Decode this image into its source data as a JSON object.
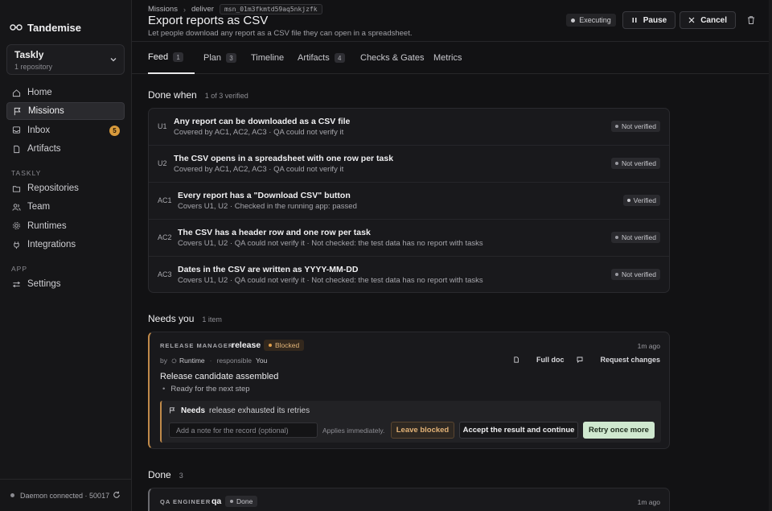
{
  "brand": {
    "name": "Tandemise"
  },
  "workspace": {
    "name": "Taskly",
    "sub": "1 repository"
  },
  "nav": {
    "main": [
      {
        "label": "Home",
        "icon": "home-icon"
      },
      {
        "label": "Missions",
        "icon": "flag-icon",
        "active": true
      },
      {
        "label": "Inbox",
        "icon": "inbox-icon",
        "badge": "5"
      },
      {
        "label": "Artifacts",
        "icon": "file-icon"
      }
    ],
    "section1": "TASKLY",
    "taskly": [
      {
        "label": "Repositories",
        "icon": "folder-icon"
      },
      {
        "label": "Team",
        "icon": "users-icon"
      },
      {
        "label": "Runtimes",
        "icon": "gear-icon"
      },
      {
        "label": "Integrations",
        "icon": "plug-icon"
      }
    ],
    "section2": "APP",
    "app": [
      {
        "label": "Settings",
        "icon": "sliders-icon"
      }
    ]
  },
  "footer": {
    "status": "Daemon connected · 50017"
  },
  "header": {
    "crumb1": "Missions",
    "crumb2": "deliver",
    "mission_id": "msn_01m3fkmtd59aq5nkjzfk",
    "title": "Export reports as CSV",
    "subtitle": "Let people download any report as a CSV file they can open in a spreadsheet.",
    "status": "Executing",
    "pause_label": "Pause",
    "cancel_label": "Cancel"
  },
  "tabs": [
    {
      "label": "Feed",
      "count": "1",
      "active": true
    },
    {
      "label": "Plan",
      "count": "3"
    },
    {
      "label": "Timeline"
    },
    {
      "label": "Artifacts",
      "count": "4"
    },
    {
      "label": "Checks & Gates"
    },
    {
      "label": "Metrics"
    }
  ],
  "done_when": {
    "title": "Done when",
    "summary": "1 of 3 verified",
    "criteria": [
      {
        "id": "U1",
        "title": "Any report can be downloaded as a CSV file",
        "sub": "Covered by AC1, AC2, AC3 · QA could not verify it",
        "status": "Not verified"
      },
      {
        "id": "U2",
        "title": "The CSV opens in a spreadsheet with one row per task",
        "sub": "Covered by AC1, AC2, AC3 · QA could not verify it",
        "status": "Not verified"
      },
      {
        "id": "AC1",
        "title": "Every report has a \"Download CSV\" button",
        "sub": "Covers U1, U2 · Checked in the running app: passed",
        "status": "Verified"
      },
      {
        "id": "AC2",
        "title": "The CSV has a header row and one row per task",
        "sub": "Covers U1, U2 · QA could not verify it · Not checked: the test data has no report with tasks",
        "status": "Not verified"
      },
      {
        "id": "AC3",
        "title": "Dates in the CSV are written as YYYY-MM-DD",
        "sub": "Covers U1, U2 · QA could not verify it · Not checked: the test data has no report with tasks",
        "status": "Not verified"
      }
    ]
  },
  "needs_you": {
    "title": "Needs you",
    "summary": "1 item",
    "item": {
      "role": "RELEASE MANAGER",
      "name": "release",
      "state": "Blocked",
      "ago": "1m ago",
      "by": "by",
      "by_name": "Runtime",
      "responsible": "responsible",
      "responsible_name": "You",
      "full_doc": "Full doc",
      "request_changes": "Request changes",
      "headline": "Release candidate assembled",
      "bullet": "Ready for the next step",
      "needs_label": "Needs",
      "needs_msg": "release exhausted its retries",
      "note_placeholder": "Add a note for the record (optional)",
      "applies": "Applies immediately.",
      "leave_label": "Leave blocked",
      "accept_label": "Accept the result and continue",
      "retry_label": "Retry once more"
    }
  },
  "done": {
    "title": "Done",
    "count": "3",
    "item": {
      "role": "QA ENGINEER",
      "name": "qa",
      "state": "Done",
      "ago": "1m ago"
    }
  }
}
